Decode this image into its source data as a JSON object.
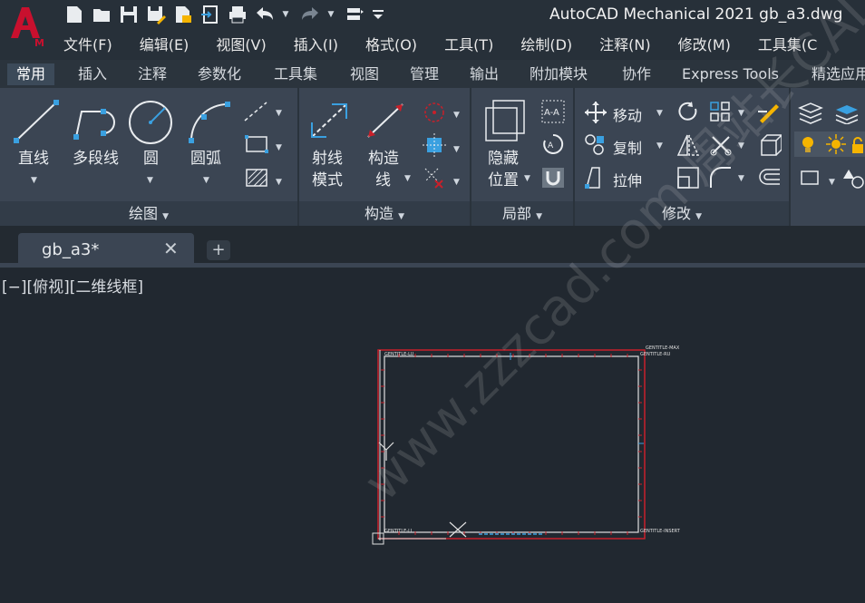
{
  "app": {
    "title": "AutoCAD Mechanical 2021    gb_a3.dwg",
    "logo_letter": "A",
    "logo_badge": "M"
  },
  "menu": [
    "文件(F)",
    "编辑(E)",
    "视图(V)",
    "插入(I)",
    "格式(O)",
    "工具(T)",
    "绘制(D)",
    "注释(N)",
    "修改(M)",
    "工具集(C"
  ],
  "ribbon_tabs": [
    "常用",
    "插入",
    "注释",
    "参数化",
    "工具集",
    "视图",
    "管理",
    "输出",
    "附加模块",
    "协作",
    "Express Tools",
    "精选应用"
  ],
  "panels": {
    "draw": {
      "footer": "绘图",
      "line": "直线",
      "polyline": "多段线",
      "circle": "圆",
      "arc": "圆弧"
    },
    "construct": {
      "footer": "构造",
      "ray_mode_1": "射线",
      "ray_mode_2": "模式",
      "xline_1": "构造",
      "xline_2": "线"
    },
    "local": {
      "footer": "局部",
      "hide_1": "隐藏",
      "hide_2": "位置"
    },
    "modify": {
      "footer": "修改",
      "move": "移动",
      "copy": "复制",
      "stretch": "拉伸"
    }
  },
  "doc_tab": {
    "label": "gb_a3*",
    "close": "✕",
    "add": "+"
  },
  "viewport": {
    "label": "[−][俯视][二维线框]"
  },
  "drawing": {
    "label_top_left": "GENTITLE-LU",
    "label_top_right_1": "GENTITLE-MAX",
    "label_top_right_2": "GENTITLE-RU",
    "label_bottom_left": "GENTITLE-LL",
    "label_bottom_right": "GENTITLE-INSERT"
  },
  "watermark": "www.zzzcad.com  周站长CAD",
  "colors": {
    "accent_red": "#c8102e",
    "frame_red": "#c8202a",
    "ribbon": "#3b4553",
    "background": "#212830"
  }
}
